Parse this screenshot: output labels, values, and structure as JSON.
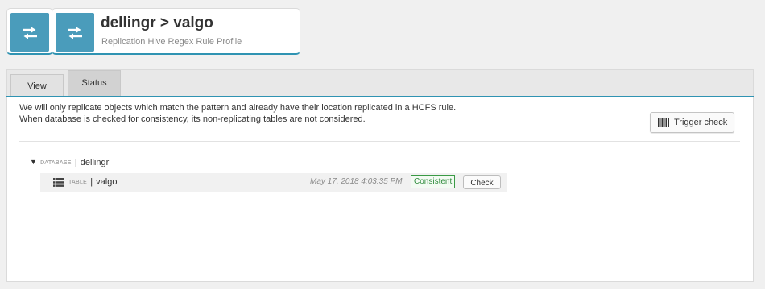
{
  "header": {
    "title": "dellingr > valgo",
    "subtitle": "Replication Hive Regex Rule Profile",
    "icon": "replication-arrows-icon",
    "accent_color": "#2f93b2",
    "tile_color": "#4a9cbb"
  },
  "tabs": [
    {
      "label": "View",
      "active": false
    },
    {
      "label": "Status",
      "active": true
    }
  ],
  "info": {
    "line1": "We will only replicate objects which match the pattern and already have their location replicated in a HCFS rule.",
    "line2": "When database is checked for consistency, its non-replicating tables are not considered."
  },
  "trigger_button": {
    "label": "Trigger check",
    "icon": "barcode-icon"
  },
  "tree": {
    "database": {
      "type_label": "DATABASE",
      "separator": "|",
      "name": "dellingr",
      "expanded": true
    },
    "tables": [
      {
        "type_label": "TABLE",
        "separator": "|",
        "name": "valgo",
        "timestamp": "May 17, 2018 4:03:35 PM",
        "status": "Consistent",
        "status_color": "#2e8b3c",
        "action_label": "Check"
      }
    ]
  }
}
